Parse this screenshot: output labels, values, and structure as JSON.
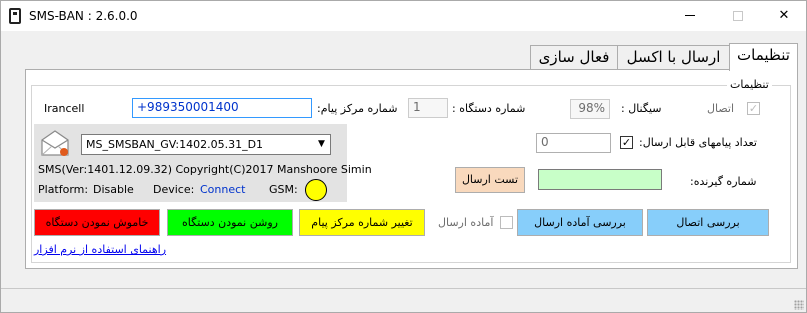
{
  "window": {
    "title": "SMS-BAN : 2.6.0.0"
  },
  "tabs": [
    {
      "label": "تنظیمات",
      "active": true
    },
    {
      "label": "ارسال با اکسل",
      "active": false
    },
    {
      "label": "فعال سازی",
      "active": false
    }
  ],
  "settings": {
    "group_title": "تنظیمات",
    "connection_label": "اتصال",
    "connection_checked": true,
    "signal_label": "سیگنال :",
    "signal_value": "98%",
    "device_number_label": "شماره دستگاه :",
    "device_number_value": "1",
    "center_number_label": "شماره مرکز پیام:",
    "center_number_value": "+989350001400",
    "operator": "Irancell",
    "sendable_count_label": "تعداد پیامهای قابل ارسال:",
    "sendable_count_checked": true,
    "sendable_count_value": "0",
    "receiver_label": "شماره گیرنده:",
    "receiver_value": "",
    "test_send_button": "تست ارسال"
  },
  "device": {
    "selected_device": "MS_SMSBAN_GV:1402.05.31_D1",
    "version_line": "SMS(Ver:1401.12.09.32) Copyright(C)2017 Manshoore Simin",
    "platform_label": "Platform:",
    "platform_value": "Disable",
    "device_label": "Device:",
    "device_value": "Connect",
    "gsm_label": "GSM:",
    "gsm_status_color": "#ffff00"
  },
  "actions": {
    "power_off": "خاموش نمودن دستگاه",
    "power_on": "روشن نمودن دستگاه",
    "change_center": "تغییر شماره مرکز پیام",
    "ready_label": "آماده ارسال",
    "check_ready": "بررسی آماده ارسال",
    "check_connection": "بررسی اتصال"
  },
  "help_link": "راهنمای استفاده از نرم افزار",
  "colors": {
    "power_off": "#ff0000",
    "power_on": "#00ff00",
    "change_center": "#ffff00",
    "check_blue": "#87cefa",
    "test_send": "#f9d9bd",
    "receiver": "#c8ffc8"
  }
}
